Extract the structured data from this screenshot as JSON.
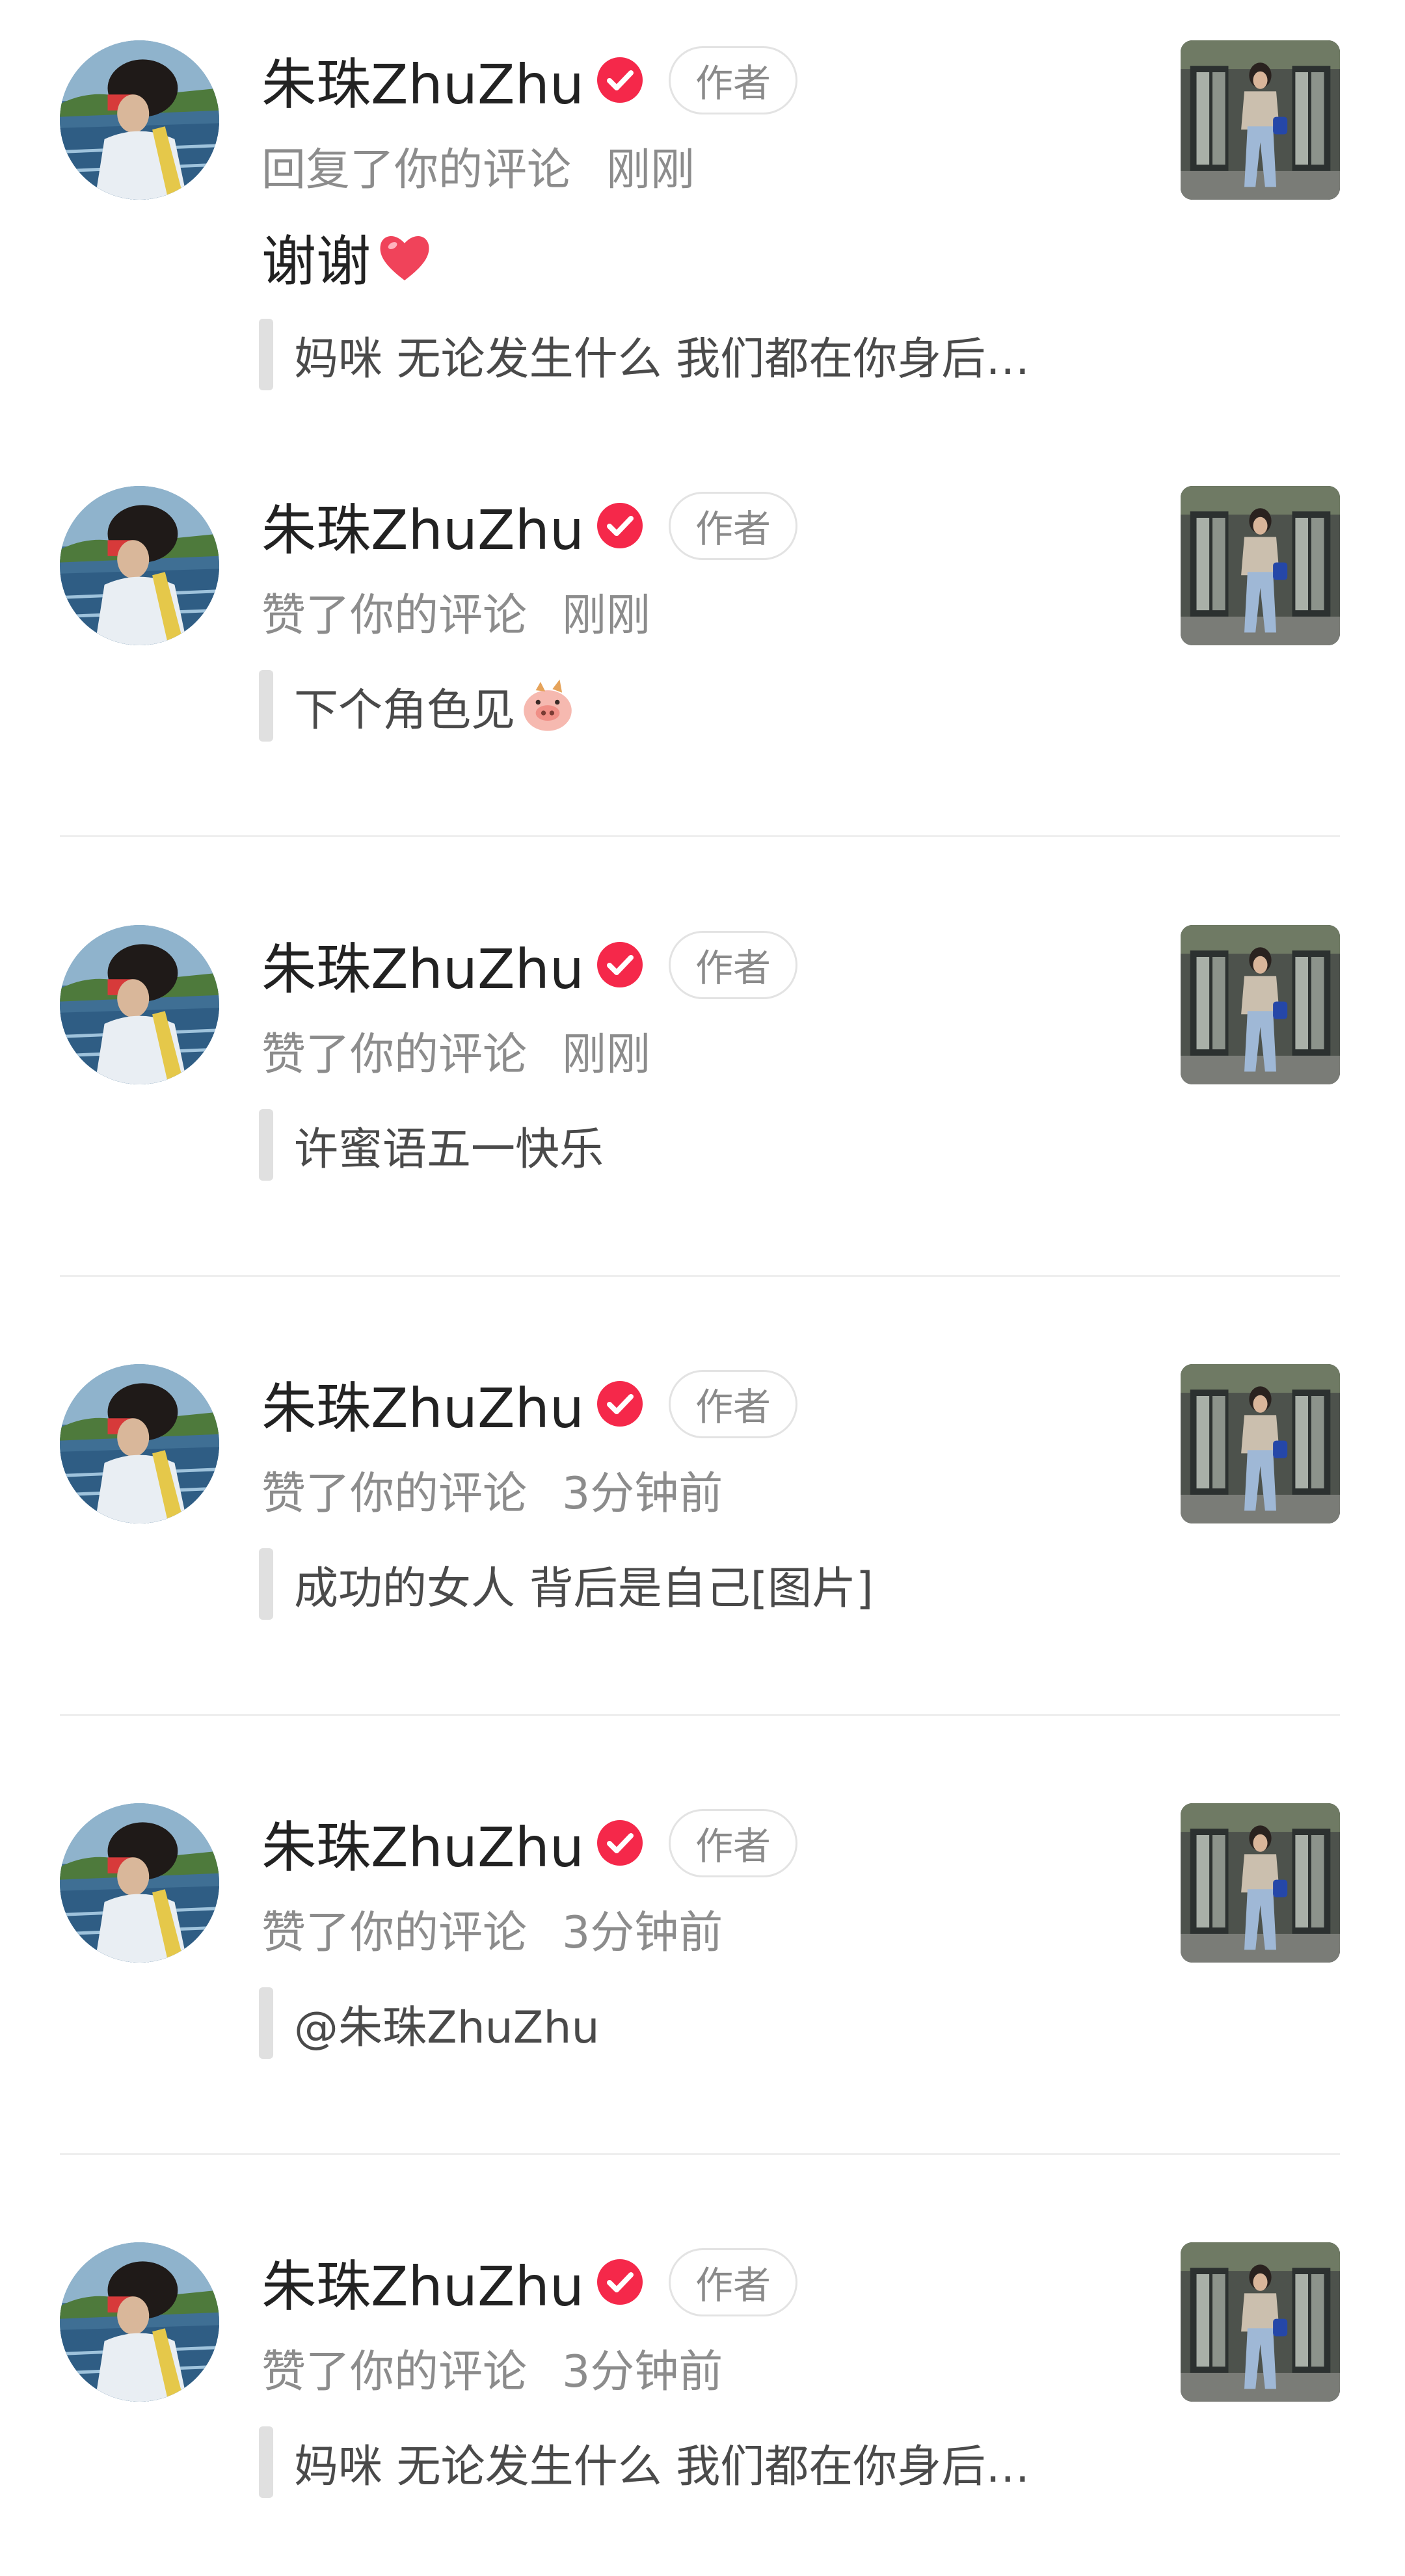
{
  "notifications": [
    {
      "username": "朱珠ZhuZhu",
      "badge": "作者",
      "action": "回复了你的评论",
      "time": "刚刚",
      "reply": "谢谢",
      "reply_icon": "red-heart-icon",
      "quote": "妈咪 无论发生什么 我们都在你身后…"
    },
    {
      "username": "朱珠ZhuZhu",
      "badge": "作者",
      "action": "赞了你的评论",
      "time": "刚刚",
      "quote": "下个角色见",
      "quote_icon": "pig-sticker-icon"
    },
    {
      "username": "朱珠ZhuZhu",
      "badge": "作者",
      "action": "赞了你的评论",
      "time": "刚刚",
      "quote": "许蜜语五一快乐"
    },
    {
      "username": "朱珠ZhuZhu",
      "badge": "作者",
      "action": "赞了你的评论",
      "time": "3分钟前",
      "quote": "成功的女人 背后是自己[图片]"
    },
    {
      "username": "朱珠ZhuZhu",
      "badge": "作者",
      "action": "赞了你的评论",
      "time": "3分钟前",
      "quote": "@朱珠ZhuZhu"
    },
    {
      "username": "朱珠ZhuZhu",
      "badge": "作者",
      "action": "赞了你的评论",
      "time": "3分钟前",
      "quote": "妈咪 无论发生什么 我们都在你身后…"
    }
  ],
  "colors": {
    "verified_badge": "#f5284a",
    "heart": "#f0435a",
    "divider": "#eeeeee"
  }
}
